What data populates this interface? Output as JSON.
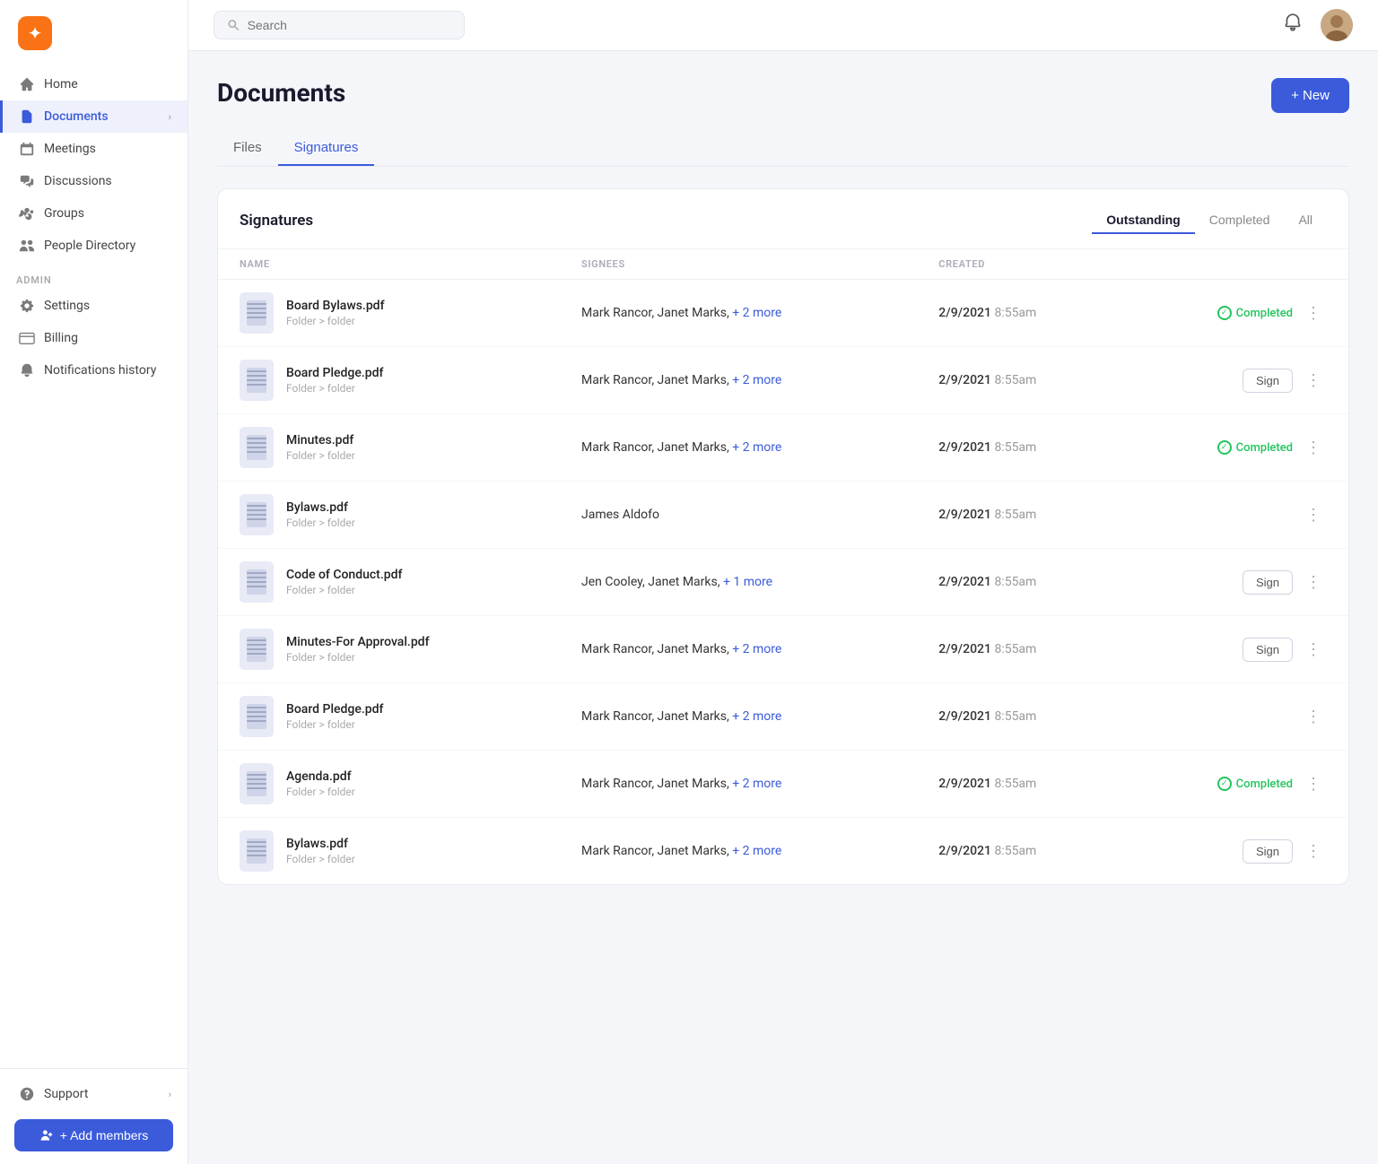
{
  "app": {
    "logo_symbol": "✦",
    "logo_alt": "App Logo"
  },
  "sidebar": {
    "nav_items": [
      {
        "id": "home",
        "label": "Home",
        "icon": "home"
      },
      {
        "id": "documents",
        "label": "Documents",
        "icon": "document",
        "has_chevron": true,
        "active": true
      },
      {
        "id": "meetings",
        "label": "Meetings",
        "icon": "meetings"
      },
      {
        "id": "discussions",
        "label": "Discussions",
        "icon": "discussions"
      },
      {
        "id": "groups",
        "label": "Groups",
        "icon": "groups"
      },
      {
        "id": "people-directory",
        "label": "People Directory",
        "icon": "people"
      }
    ],
    "admin_label": "ADMIN",
    "admin_items": [
      {
        "id": "settings",
        "label": "Settings",
        "icon": "settings"
      },
      {
        "id": "billing",
        "label": "Billing",
        "icon": "billing"
      },
      {
        "id": "notifications",
        "label": "Notifications history",
        "icon": "bell"
      }
    ],
    "support": {
      "label": "Support",
      "has_chevron": true
    },
    "add_members_label": "+ Add members"
  },
  "topbar": {
    "search_placeholder": "Search"
  },
  "page": {
    "title": "Documents",
    "new_button_label": "+ New"
  },
  "tabs": [
    {
      "id": "files",
      "label": "Files"
    },
    {
      "id": "signatures",
      "label": "Signatures",
      "active": true
    }
  ],
  "signatures": {
    "title": "Signatures",
    "filters": [
      {
        "id": "outstanding",
        "label": "Outstanding",
        "active": true
      },
      {
        "id": "completed",
        "label": "Completed"
      },
      {
        "id": "all",
        "label": "All"
      }
    ],
    "columns": [
      {
        "id": "name",
        "label": "NAME"
      },
      {
        "id": "signees",
        "label": "SIGNEES"
      },
      {
        "id": "created",
        "label": "CREATED"
      },
      {
        "id": "status",
        "label": ""
      }
    ],
    "rows": [
      {
        "id": 1,
        "name": "Board Bylaws.pdf",
        "path": "Folder > folder",
        "signees": "Mark Rancor, Janet Marks,",
        "signees_more": "+ 2 more",
        "created_date": "2/9/2021",
        "created_time": "8:55am",
        "status": "completed",
        "action_label": ""
      },
      {
        "id": 2,
        "name": "Board Pledge.pdf",
        "path": "Folder > folder",
        "signees": "Mark Rancor, Janet Marks,",
        "signees_more": "+ 2 more",
        "created_date": "2/9/2021",
        "created_time": "8:55am",
        "status": "sign",
        "action_label": "Sign"
      },
      {
        "id": 3,
        "name": "Minutes.pdf",
        "path": "Folder > folder",
        "signees": "Mark Rancor, Janet Marks,",
        "signees_more": "+ 2 more",
        "created_date": "2/9/2021",
        "created_time": "8:55am",
        "status": "completed",
        "action_label": ""
      },
      {
        "id": 4,
        "name": "Bylaws.pdf",
        "path": "Folder > folder",
        "signees": "James Aldofo",
        "signees_more": "",
        "created_date": "2/9/2021",
        "created_time": "8:55am",
        "status": "none",
        "action_label": ""
      },
      {
        "id": 5,
        "name": "Code of Conduct.pdf",
        "path": "Folder > folder",
        "signees": "Jen Cooley, Janet Marks,",
        "signees_more": "+ 1 more",
        "created_date": "2/9/2021",
        "created_time": "8:55am",
        "status": "sign",
        "action_label": "Sign"
      },
      {
        "id": 6,
        "name": "Minutes-For Approval.pdf",
        "path": "Folder > folder",
        "signees": "Mark Rancor, Janet Marks,",
        "signees_more": "+ 2 more",
        "created_date": "2/9/2021",
        "created_time": "8:55am",
        "status": "sign",
        "action_label": "Sign"
      },
      {
        "id": 7,
        "name": "Board Pledge.pdf",
        "path": "Folder > folder",
        "signees": "Mark Rancor, Janet Marks,",
        "signees_more": "+ 2 more",
        "created_date": "2/9/2021",
        "created_time": "8:55am",
        "status": "none",
        "action_label": ""
      },
      {
        "id": 8,
        "name": "Agenda.pdf",
        "path": "Folder > folder",
        "signees": "Mark Rancor, Janet Marks,",
        "signees_more": "+ 2 more",
        "created_date": "2/9/2021",
        "created_time": "8:55am",
        "status": "completed",
        "action_label": ""
      },
      {
        "id": 9,
        "name": "Bylaws.pdf",
        "path": "Folder > folder",
        "signees": "Mark Rancor, Janet Marks,",
        "signees_more": "+ 2 more",
        "created_date": "2/9/2021",
        "created_time": "8:55am",
        "status": "sign",
        "action_label": "Sign"
      }
    ],
    "completed_label": "Completed"
  }
}
